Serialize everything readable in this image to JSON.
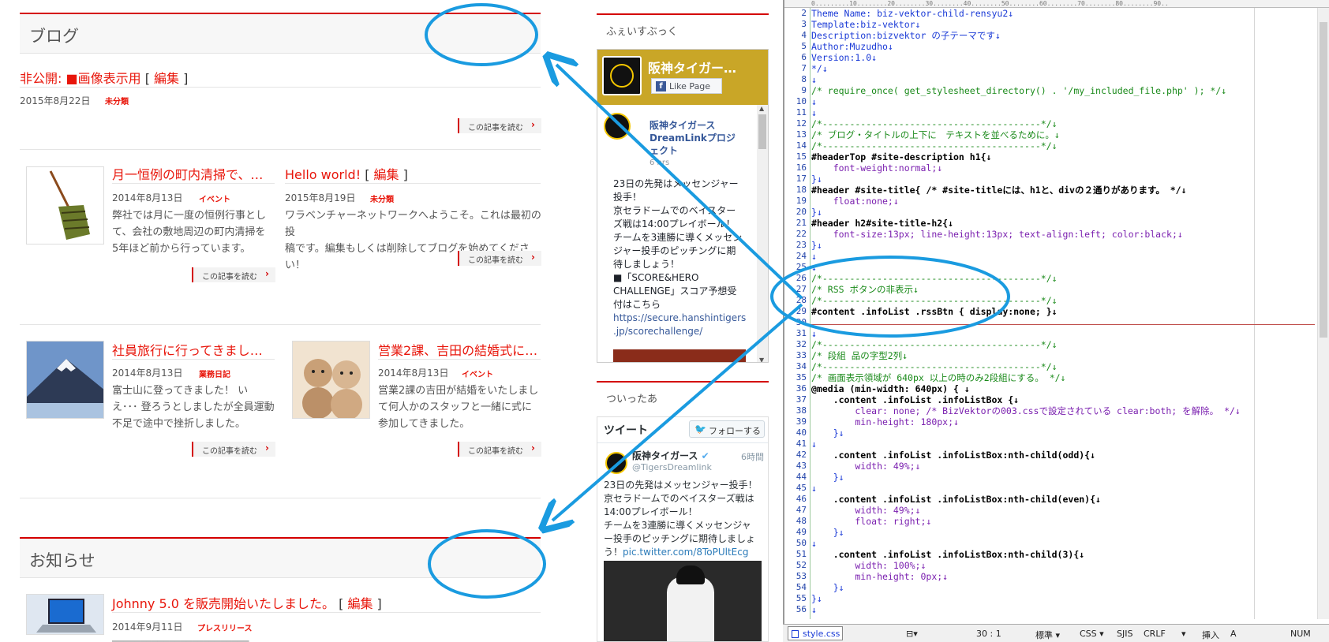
{
  "blog": {
    "title": "ブログ",
    "post1": {
      "prefix": "非公開: ■画像表示用",
      "bracket_open": " [ ",
      "edit": "編集",
      "bracket_close": " ]",
      "date": "2015年8月22日",
      "cat": "未分類",
      "read": "この記事を読む"
    },
    "post2": {
      "title": "月一恒例の町内清掃で、…",
      "date": "2014年8月13日",
      "cat": "イベント",
      "excerpt1": "弊社では月に一度の恒例行事として、会社の敷地周辺の町内清掃を",
      "excerpt2": "5年ほど前から行っています。",
      "read": "この記事を読む"
    },
    "post3": {
      "title": "Hello world!",
      "bracket_open": " [ ",
      "edit": "編集",
      "bracket_close": " ]",
      "date": "2015年8月19日",
      "cat": "未分類",
      "excerpt1": "ワラベンチャーネットワークへようこそ。これは最初の投",
      "excerpt2": "稿です。編集もしくは削除してブログを始めてください！",
      "read": "この記事を読む"
    },
    "post4": {
      "title": "社員旅行に行ってきまし…",
      "date": "2014年8月13日",
      "cat": "業務日記",
      "excerpt1": "富士山に登ってきました！ い",
      "excerpt2": "え･･･ 登ろうとしましたが全員運動",
      "excerpt3": "不足で途中で挫折しました。",
      "read": "この記事を読む"
    },
    "post5": {
      "title": "営業2課、吉田の結婚式に…",
      "date": "2014年8月13日",
      "cat": "イベント",
      "excerpt1": "営業2課の吉田が結婚をいたしまし",
      "excerpt2": "て何人かのスタッフと一緒に式に",
      "excerpt3": "参加してきました。",
      "read": "この記事を読む"
    }
  },
  "news": {
    "title": "お知らせ",
    "post1": {
      "title": "Johnny 5.0 を販売開始いたしました。",
      "bracket_open": " [ ",
      "edit": "編集",
      "bracket_close": " ]",
      "date": "2014年9月11日",
      "cat": "プレスリリース"
    }
  },
  "facebook": {
    "title": "ふぇいすぶっく",
    "page_name": "阪神タイガー…",
    "like_label": "Like Page",
    "post_author": "阪神タイガース DreamLinkプロジェクト",
    "post_time": "6 hrs",
    "post_text": [
      "23日の先発はメッセンジャー",
      "投手！",
      "京セラドームでのベイスター",
      "ズ戦は14:00プレイボール！",
      "チームを3連勝に導くメッセン",
      "ジャー投手のピッチングに期",
      "待しましょう！",
      "■「SCORE&HERO",
      "CHALLENGE」スコア予想受",
      "付はこちら"
    ],
    "post_link": [
      "https://secure.hanshintigers",
      ".jp/scorechallenge/"
    ]
  },
  "twitter": {
    "title": "ついったあ",
    "tweets_label": "ツイート",
    "follow_label": "フォローする",
    "user_name": "阪神タイガース",
    "user_handle": "@TigersDreamlink",
    "time": "6時間",
    "text": [
      "23日の先発はメッセンジャー投手！",
      "京セラドームでのベイスターズ戦は",
      "14:00プレイボール！",
      "チームを3連勝に導くメッセンジャ",
      "ー投手のピッチングに期待しましょ"
    ],
    "text_last": "う！",
    "link": "pic.twitter.com/8ToPUltEcg"
  },
  "editor": {
    "lines": [
      {
        "n": "2",
        "t": "Theme Name: biz-vektor-child-rensyu2↓",
        "c": "c-blue"
      },
      {
        "n": "3",
        "t": "Template:biz-vektor↓",
        "c": "c-blue"
      },
      {
        "n": "4",
        "t": "Description:bizvektor の子テーマです↓",
        "c": "c-blue"
      },
      {
        "n": "5",
        "t": "Author:Muzudho↓",
        "c": "c-blue"
      },
      {
        "n": "6",
        "t": "Version:1.0↓",
        "c": "c-blue"
      },
      {
        "n": "7",
        "t": "*/↓",
        "c": "c-blue"
      },
      {
        "n": "8",
        "t": "↓",
        "c": "c-blue"
      },
      {
        "n": "9",
        "t": "/* require_once( get_stylesheet_directory() . '/my_included_file.php' ); */↓",
        "c": "c-com"
      },
      {
        "n": "10",
        "t": "↓",
        "c": "c-blue"
      },
      {
        "n": "11",
        "t": "↓",
        "c": "c-blue"
      },
      {
        "n": "12",
        "t": "/*----------------------------------------*/↓",
        "c": "c-com"
      },
      {
        "n": "13",
        "t": "/* ブログ・タイトルの上下に　テキストを並べるために。↓",
        "c": "c-com"
      },
      {
        "n": "14",
        "t": "/*----------------------------------------*/↓",
        "c": "c-com"
      },
      {
        "n": "15",
        "t": "#headerTop #site-description h1{↓",
        "c": "c-sel"
      },
      {
        "n": "16",
        "t": "    font-weight:normal;↓",
        "c": "c-prop"
      },
      {
        "n": "17",
        "t": "}↓",
        "c": "c-blue"
      },
      {
        "n": "18",
        "t": "#header #site-title{ /* #site-titleには、h1と、divの２通りがあります。 */↓",
        "c": "c-sel"
      },
      {
        "n": "19",
        "t": "    float:none;↓",
        "c": "c-prop"
      },
      {
        "n": "20",
        "t": "}↓",
        "c": "c-blue"
      },
      {
        "n": "21",
        "t": "#header h2#site-title-h2{↓",
        "c": "c-sel"
      },
      {
        "n": "22",
        "t": "    font-size:13px; line-height:13px; text-align:left; color:black;↓",
        "c": "c-prop"
      },
      {
        "n": "23",
        "t": "}↓",
        "c": "c-blue"
      },
      {
        "n": "24",
        "t": "↓",
        "c": "c-blue"
      },
      {
        "n": "25",
        "t": "↓",
        "c": "c-blue"
      },
      {
        "n": "26",
        "t": "/*----------------------------------------*/↓",
        "c": "c-com"
      },
      {
        "n": "27",
        "t": "/* RSS ボタンの非表示↓",
        "c": "c-com"
      },
      {
        "n": "28",
        "t": "/*----------------------------------------*/↓",
        "c": "c-com"
      },
      {
        "n": "29",
        "t": "#content .infoList .rssBtn { display:none; }↓",
        "c": "c-sel"
      },
      {
        "n": "30",
        "t": "",
        "c": "c-blue"
      },
      {
        "n": "31",
        "t": "↓",
        "c": "c-blue"
      },
      {
        "n": "32",
        "t": "/*----------------------------------------*/↓",
        "c": "c-com"
      },
      {
        "n": "33",
        "t": "/* 段組 品の字型2列↓",
        "c": "c-com"
      },
      {
        "n": "34",
        "t": "/*----------------------------------------*/↓",
        "c": "c-com"
      },
      {
        "n": "35",
        "t": "/* 画面表示領域が 640px 以上の時のみ2段組にする。 */↓",
        "c": "c-com"
      },
      {
        "n": "36",
        "t": "@media (min-width: 640px) { ↓",
        "c": "c-sel"
      },
      {
        "n": "37",
        "t": "    .content .infoList .infoListBox {↓",
        "c": "c-sel"
      },
      {
        "n": "38",
        "t": "        clear: none; /* BizVektorの003.cssで設定されている clear:both; を解除。 */↓",
        "c": "c-prop"
      },
      {
        "n": "39",
        "t": "        min-height: 180px;↓",
        "c": "c-prop"
      },
      {
        "n": "40",
        "t": "    }↓",
        "c": "c-blue"
      },
      {
        "n": "41",
        "t": "↓",
        "c": "c-blue"
      },
      {
        "n": "42",
        "t": "    .content .infoList .infoListBox:nth-child(odd){↓",
        "c": "c-sel"
      },
      {
        "n": "43",
        "t": "        width: 49%;↓",
        "c": "c-prop"
      },
      {
        "n": "44",
        "t": "    }↓",
        "c": "c-blue"
      },
      {
        "n": "45",
        "t": "↓",
        "c": "c-blue"
      },
      {
        "n": "46",
        "t": "    .content .infoList .infoListBox:nth-child(even){↓",
        "c": "c-sel"
      },
      {
        "n": "47",
        "t": "        width: 49%;↓",
        "c": "c-prop"
      },
      {
        "n": "48",
        "t": "        float: right;↓",
        "c": "c-prop"
      },
      {
        "n": "49",
        "t": "    }↓",
        "c": "c-blue"
      },
      {
        "n": "50",
        "t": "↓",
        "c": "c-blue"
      },
      {
        "n": "51",
        "t": "    .content .infoList .infoListBox:nth-child(3){↓",
        "c": "c-sel"
      },
      {
        "n": "52",
        "t": "        width: 100%;↓",
        "c": "c-prop"
      },
      {
        "n": "53",
        "t": "        min-height: 0px;↓",
        "c": "c-prop"
      },
      {
        "n": "54",
        "t": "    }↓",
        "c": "c-blue"
      },
      {
        "n": "55",
        "t": "}↓",
        "c": "c-blue"
      },
      {
        "n": "56",
        "t": "↓",
        "c": "c-blue"
      }
    ],
    "ruler": "0.........10........20........30........40........50........60........70........80........90..",
    "tab_name": "style.css",
    "status": {
      "pos": "30 : 1",
      "mode": "標準",
      "lang": "CSS",
      "enc": "SJIS",
      "eol": "CRLF",
      "ins": "挿入",
      "a": "A",
      "num": "NUM"
    }
  },
  "colors": {
    "accent": "#d40000",
    "annotation": "#1a9be0"
  }
}
